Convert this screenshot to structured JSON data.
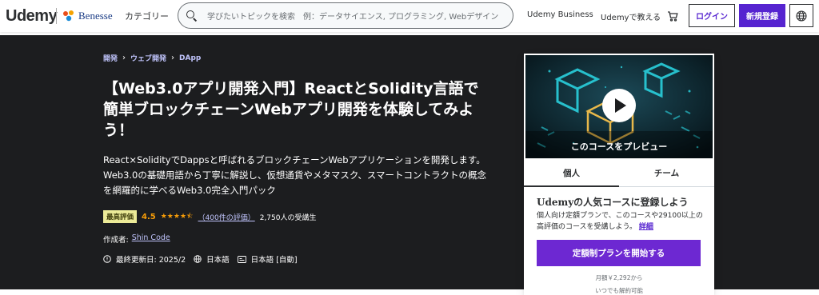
{
  "header": {
    "logo": "Udemy",
    "partner": "Benesse",
    "category": "カテゴリー",
    "search_placeholder": "学びたいトピックを検索　例：データサイエンス, プログラミング, Webデザイン",
    "business": "Udemy Business",
    "teach": "Udemyで教える",
    "login": "ログイン",
    "signup": "新規登録",
    "icons": {
      "search": "search-icon",
      "cart": "cart-icon",
      "globe": "globe-icon"
    }
  },
  "breadcrumb": [
    "開発",
    "ウェブ開発",
    "DApp"
  ],
  "course": {
    "title": "【Web3.0アプリ開発入門】ReactとSolidity言語で簡単ブロックチェーンWebアプリ開発を体験してみよう！",
    "subtitle": "React×SolidityでDappsと呼ばれるブロックチェーンWebアプリケーションを開発します。Web3.0の基礎用語から丁寧に解説し、仮想通貨やメタマスク、スマートコントラクトの概念を網羅的に学べるWeb3.0完全入門パック",
    "badge": "最高評価",
    "rating": "4.5",
    "rating_value": 4.5,
    "stars": "★★★★⯪",
    "reviews": "（400件の評価）",
    "students": "2,750人の受講生",
    "creator_label": "作成者:",
    "creator": "Shin Code",
    "updated": "最終更新日: 2025/2",
    "language": "日本語",
    "captions": "日本語 [自動]"
  },
  "card": {
    "preview_label": "このコースをプレビュー",
    "tabs": [
      "個人",
      "チーム"
    ],
    "plan_title": "Udemyの人気コースに登録しよう",
    "plan_desc": "個人向け定額プランで、このコースや29100以上の高評価のコースを受講しよう。",
    "plan_more": "詳細",
    "start_button": "定額制プランを開始する",
    "price": "月額￥2,292から",
    "cancel": "いつでも解約可能"
  },
  "colors": {
    "brand": "#5624d0",
    "hero_bg": "#1c1d1f",
    "link_purple": "#c0c4fc",
    "rating": "#f69c08",
    "badge": "#eceb98"
  }
}
